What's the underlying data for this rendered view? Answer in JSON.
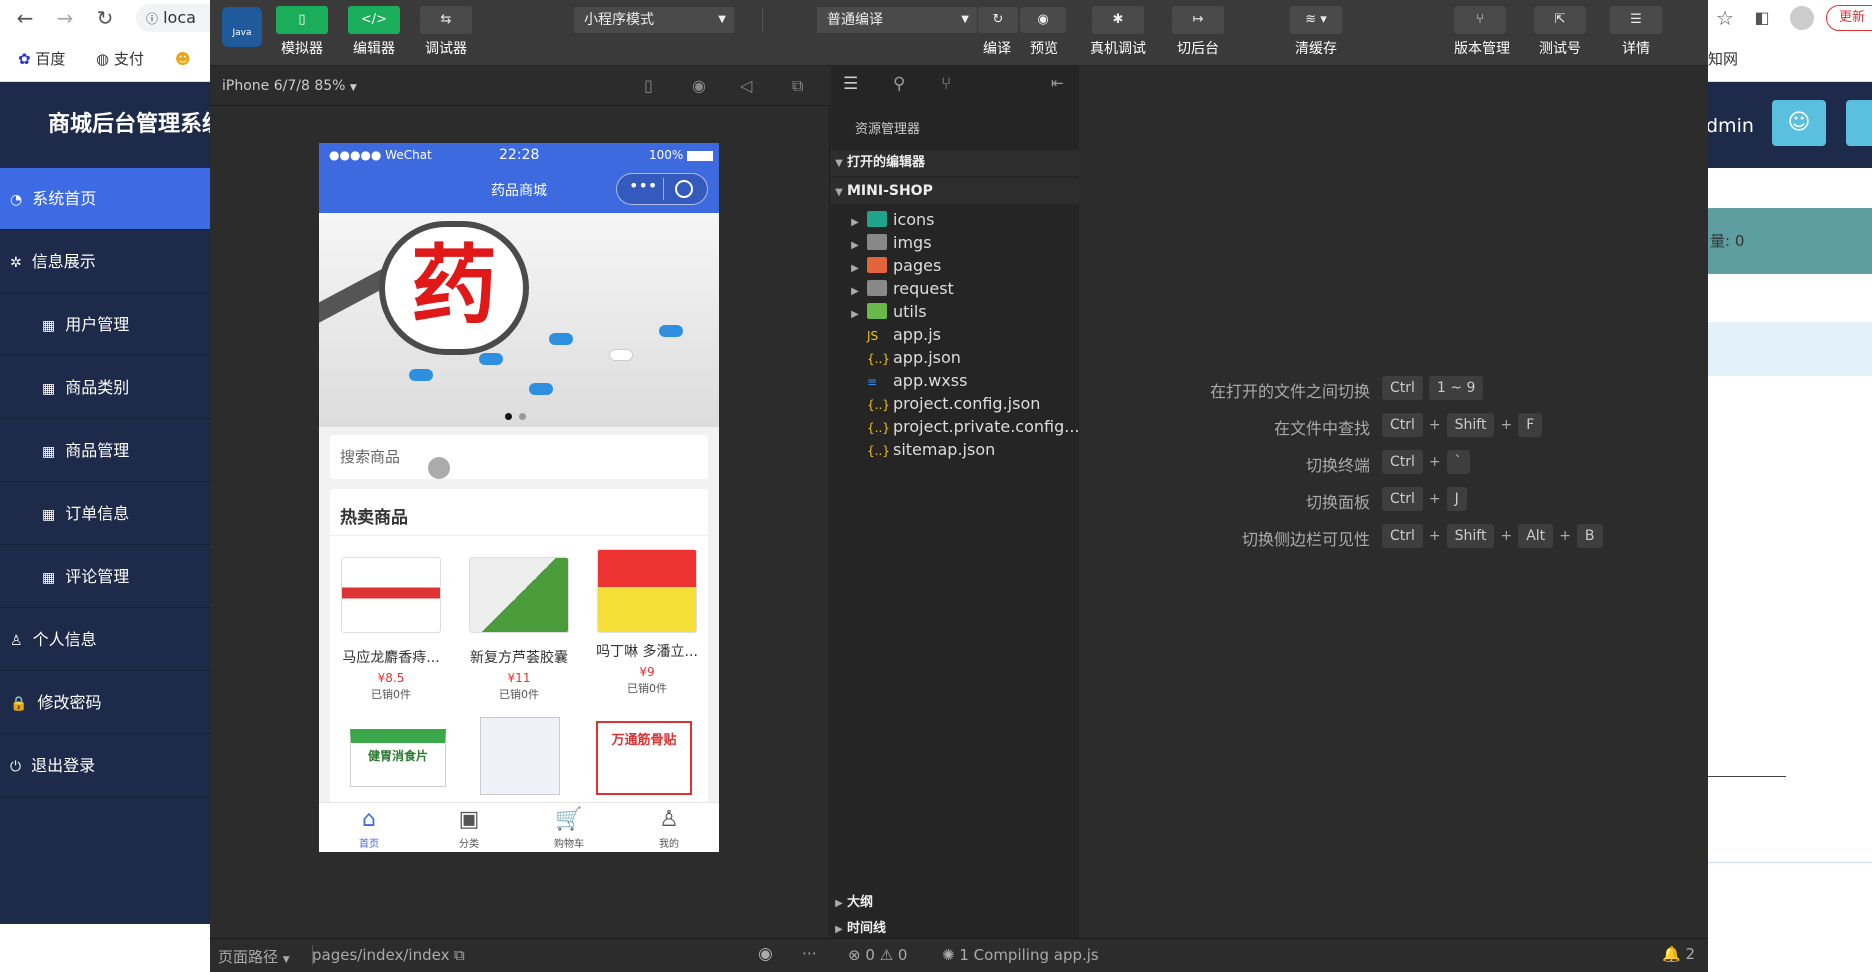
{
  "browser": {
    "address_text": "loca",
    "bookmarks": [
      "百度",
      "支付"
    ],
    "bookmark_right": "知网",
    "update_label": "更新"
  },
  "admin": {
    "title": "商城后台管理系统",
    "user_text": "dmin",
    "count_text": "量: 0",
    "menu": [
      {
        "label": "系统首页",
        "icon": "dashboard-icon"
      },
      {
        "label": "信息展示",
        "icon": "info-icon"
      },
      {
        "label": "用户管理",
        "icon": "table-icon"
      },
      {
        "label": "商品类别",
        "icon": "table-icon"
      },
      {
        "label": "商品管理",
        "icon": "table-icon"
      },
      {
        "label": "订单信息",
        "icon": "table-icon"
      },
      {
        "label": "评论管理",
        "icon": "table-icon"
      },
      {
        "label": "个人信息",
        "icon": "user-icon"
      },
      {
        "label": "修改密码",
        "icon": "lock-icon"
      },
      {
        "label": "退出登录",
        "icon": "power-icon"
      }
    ]
  },
  "toolbar": {
    "simulator": "模拟器",
    "editor": "编辑器",
    "debugger": "调试器",
    "mode": "小程序模式",
    "compile_type": "普通编译",
    "compile": "编译",
    "preview": "预览",
    "remote_debug": "真机调试",
    "background": "切后台",
    "clear_cache": "清缓存",
    "version": "版本管理",
    "test_no": "测试号",
    "details": "详情"
  },
  "sim": {
    "device": "iPhone 6/7/8 85%"
  },
  "phone": {
    "carrier": "●●●●● WeChat",
    "time": "22:28",
    "battery": "100%",
    "nav_title": "药品商城",
    "banner_text": "药",
    "search_placeholder": "搜索商品",
    "hot_title": "热卖商品",
    "products": [
      {
        "name": "马应龙麝香痔...",
        "price": "¥8.5",
        "sold": "已销0件"
      },
      {
        "name": "新复方芦荟胶囊",
        "price": "¥11",
        "sold": "已销0件"
      },
      {
        "name": "吗丁啉 多潘立...",
        "price": "¥9",
        "sold": "已销0件"
      }
    ],
    "products_row2": [
      "健胃消食片",
      "",
      "万通筋骨贴"
    ],
    "tabs": [
      {
        "label": "首页",
        "icon": "home-icon"
      },
      {
        "label": "分类",
        "icon": "category-icon"
      },
      {
        "label": "购物车",
        "icon": "cart-icon"
      },
      {
        "label": "我的",
        "icon": "user-icon"
      }
    ]
  },
  "explorer": {
    "header": "资源管理器",
    "open_editors": "打开的编辑器",
    "project": "MINI-SHOP",
    "folders": [
      "icons",
      "imgs",
      "pages",
      "request",
      "utils"
    ],
    "files": [
      "app.js",
      "app.json",
      "app.wxss",
      "project.config.json",
      "project.private.config...",
      "sitemap.json"
    ],
    "outline": "大纲",
    "timeline": "时间线"
  },
  "shortcuts": [
    {
      "desc": "在打开的文件之间切换",
      "keys": [
        "Ctrl",
        "1 ~ 9"
      ],
      "sep": ""
    },
    {
      "desc": "在文件中查找",
      "keys": [
        "Ctrl",
        "Shift",
        "F"
      ],
      "sep": "+"
    },
    {
      "desc": "切换终端",
      "keys": [
        "Ctrl",
        "`"
      ],
      "sep": "+"
    },
    {
      "desc": "切换面板",
      "keys": [
        "Ctrl",
        "J"
      ],
      "sep": "+"
    },
    {
      "desc": "切换侧边栏可见性",
      "keys": [
        "Ctrl",
        "Shift",
        "Alt",
        "B"
      ],
      "sep": "+"
    }
  ],
  "status": {
    "page_path_label": "页面路径",
    "page_path": "pages/index/index",
    "errors": "0",
    "warnings": "0",
    "compile_msg": "1 Compiling app.js",
    "notifications": "2"
  },
  "colors": {
    "accent": "#3e6ae0",
    "green": "#1aad5a",
    "price": "#e53333",
    "admin_nav": "#1e2a4a"
  }
}
